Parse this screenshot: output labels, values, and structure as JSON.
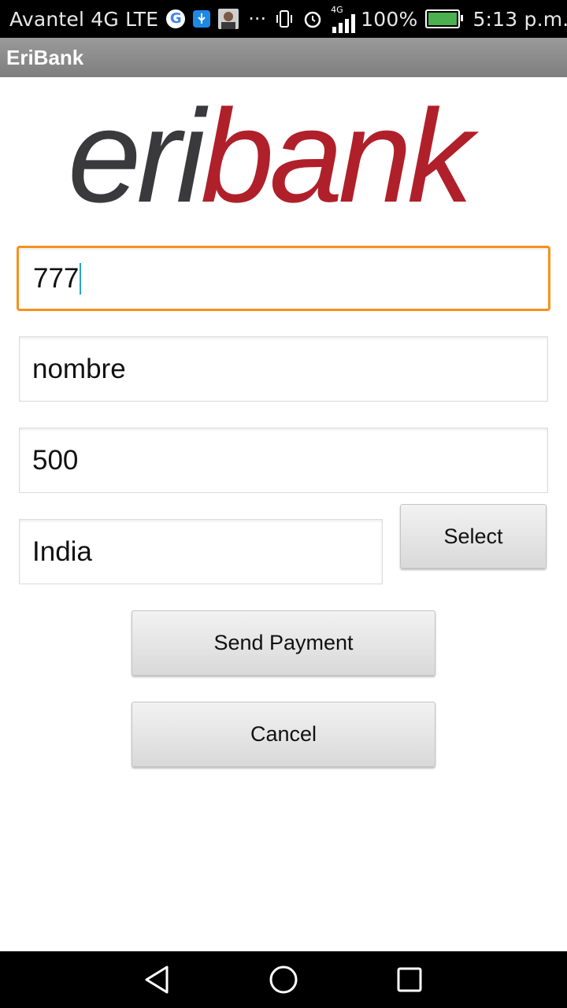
{
  "status_bar": {
    "carrier": "Avantel 4G LTE",
    "network_badge": "4G",
    "battery": "100%",
    "time": "5:13 p.m.",
    "icons": [
      "google-icon",
      "usb-icon",
      "avatar-icon",
      "more-dots-icon",
      "vibrate-icon",
      "alarm-icon",
      "signal-icon",
      "battery-icon"
    ]
  },
  "app": {
    "title": "EriBank"
  },
  "logo": {
    "part1": "eri",
    "part2": "bank",
    "colors": {
      "eri": "#3a3a3c",
      "bank": "#b0202a"
    }
  },
  "form": {
    "phone": "777",
    "name": "nombre",
    "amount": "500",
    "country": "India",
    "select_label": "Select",
    "send_label": "Send Payment",
    "cancel_label": "Cancel"
  },
  "colors": {
    "focus_border": "#f5921e",
    "action_bar": "#8c8c8c"
  },
  "nav_bar": {
    "icons": [
      "back-icon",
      "home-icon",
      "recents-icon"
    ]
  }
}
